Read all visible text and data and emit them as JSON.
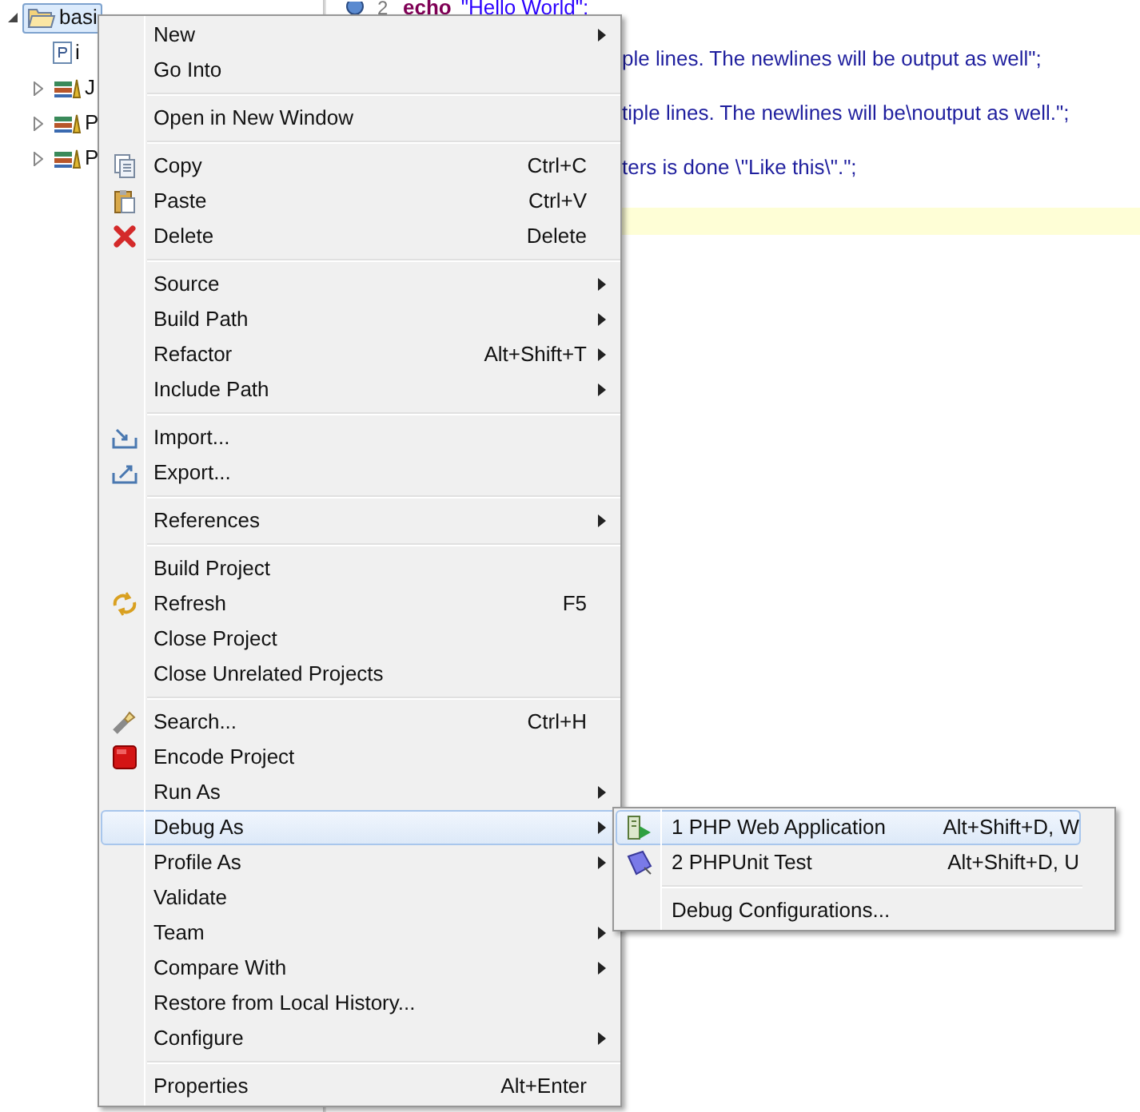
{
  "tree": [
    {
      "label": "basi",
      "kind": "project",
      "expanded": true,
      "selected": true,
      "children": [
        {
          "label": "i",
          "kind": "file",
          "selected": false
        },
        {
          "label": "J",
          "kind": "library",
          "expanded": false,
          "selected": false
        },
        {
          "label": "P",
          "kind": "library",
          "expanded": false,
          "selected": false
        },
        {
          "label": "P",
          "kind": "library",
          "expanded": false,
          "selected": false
        }
      ]
    }
  ],
  "editor": {
    "lines": [
      {
        "kind": "full",
        "number": "2",
        "keyword": "echo",
        "text": "\"Hello World\";"
      },
      {
        "kind": "blank"
      },
      {
        "kind": "partial",
        "text": "ple lines. The newlines will be output as well\";"
      },
      {
        "kind": "blank"
      },
      {
        "kind": "partial",
        "text": "tiple lines. The newlines will be\\noutput as well.\";"
      },
      {
        "kind": "blank"
      },
      {
        "kind": "partial",
        "text": "ters is done \\\"Like this\\\".\";"
      },
      {
        "kind": "blank"
      },
      {
        "kind": "current"
      }
    ]
  },
  "context_menu": {
    "sections": [
      [
        {
          "label": "New",
          "kind": "plain",
          "submenu": true,
          "selected": false
        },
        {
          "label": "Go Into",
          "kind": "plain",
          "submenu": false,
          "selected": false
        }
      ],
      [
        {
          "label": "Open in New Window",
          "kind": "plain",
          "submenu": false,
          "selected": false
        }
      ],
      [
        {
          "label": "Copy",
          "kind": "copy",
          "shortcut": "Ctrl+C",
          "submenu": false,
          "selected": false
        },
        {
          "label": "Paste",
          "kind": "paste",
          "shortcut": "Ctrl+V",
          "submenu": false,
          "selected": false
        },
        {
          "label": "Delete",
          "kind": "delete",
          "shortcut": "Delete",
          "submenu": false,
          "selected": false
        }
      ],
      [
        {
          "label": "Source",
          "kind": "plain",
          "submenu": true,
          "selected": false
        },
        {
          "label": "Build Path",
          "kind": "plain",
          "submenu": true,
          "selected": false
        },
        {
          "label": "Refactor",
          "kind": "plain",
          "shortcut": "Alt+Shift+T",
          "submenu": true,
          "selected": false
        },
        {
          "label": "Include Path",
          "kind": "plain",
          "submenu": true,
          "selected": false
        }
      ],
      [
        {
          "label": "Import...",
          "kind": "import",
          "submenu": false,
          "selected": false
        },
        {
          "label": "Export...",
          "kind": "export",
          "submenu": false,
          "selected": false
        }
      ],
      [
        {
          "label": "References",
          "kind": "plain",
          "submenu": true,
          "selected": false
        }
      ],
      [
        {
          "label": "Build Project",
          "kind": "plain",
          "submenu": false,
          "selected": false
        },
        {
          "label": "Refresh",
          "kind": "refresh",
          "shortcut": "F5",
          "submenu": false,
          "selected": false
        },
        {
          "label": "Close Project",
          "kind": "plain",
          "submenu": false,
          "selected": false
        },
        {
          "label": "Close Unrelated Projects",
          "kind": "plain",
          "submenu": false,
          "selected": false
        }
      ],
      [
        {
          "label": "Search...",
          "kind": "search",
          "shortcut": "Ctrl+H",
          "submenu": false,
          "selected": false
        },
        {
          "label": "Encode Project",
          "kind": "encode",
          "submenu": false,
          "selected": false
        },
        {
          "label": "Run As",
          "kind": "plain",
          "submenu": true,
          "selected": false
        },
        {
          "label": "Debug As",
          "kind": "plain",
          "submenu": true,
          "selected": true
        },
        {
          "label": "Profile As",
          "kind": "plain",
          "submenu": true,
          "selected": false
        },
        {
          "label": "Validate",
          "kind": "plain",
          "submenu": false,
          "selected": false
        },
        {
          "label": "Team",
          "kind": "plain",
          "submenu": true,
          "selected": false
        },
        {
          "label": "Compare With",
          "kind": "plain",
          "submenu": true,
          "selected": false
        },
        {
          "label": "Restore from Local History...",
          "kind": "plain",
          "submenu": false,
          "selected": false
        },
        {
          "label": "Configure",
          "kind": "plain",
          "submenu": true,
          "selected": false
        }
      ],
      [
        {
          "label": "Properties",
          "kind": "plain",
          "shortcut": "Alt+Enter",
          "submenu": false,
          "selected": false
        }
      ]
    ]
  },
  "submenu": {
    "sections": [
      [
        {
          "label": "1 PHP Web Application",
          "kind": "webapp",
          "shortcut": "Alt+Shift+D, W",
          "selected": true
        },
        {
          "label": "2 PHPUnit Test",
          "kind": "unittest",
          "shortcut": "Alt+Shift+D, U",
          "selected": false
        }
      ],
      [
        {
          "label": "Debug Configurations...",
          "kind": "plain",
          "selected": false
        }
      ]
    ]
  }
}
